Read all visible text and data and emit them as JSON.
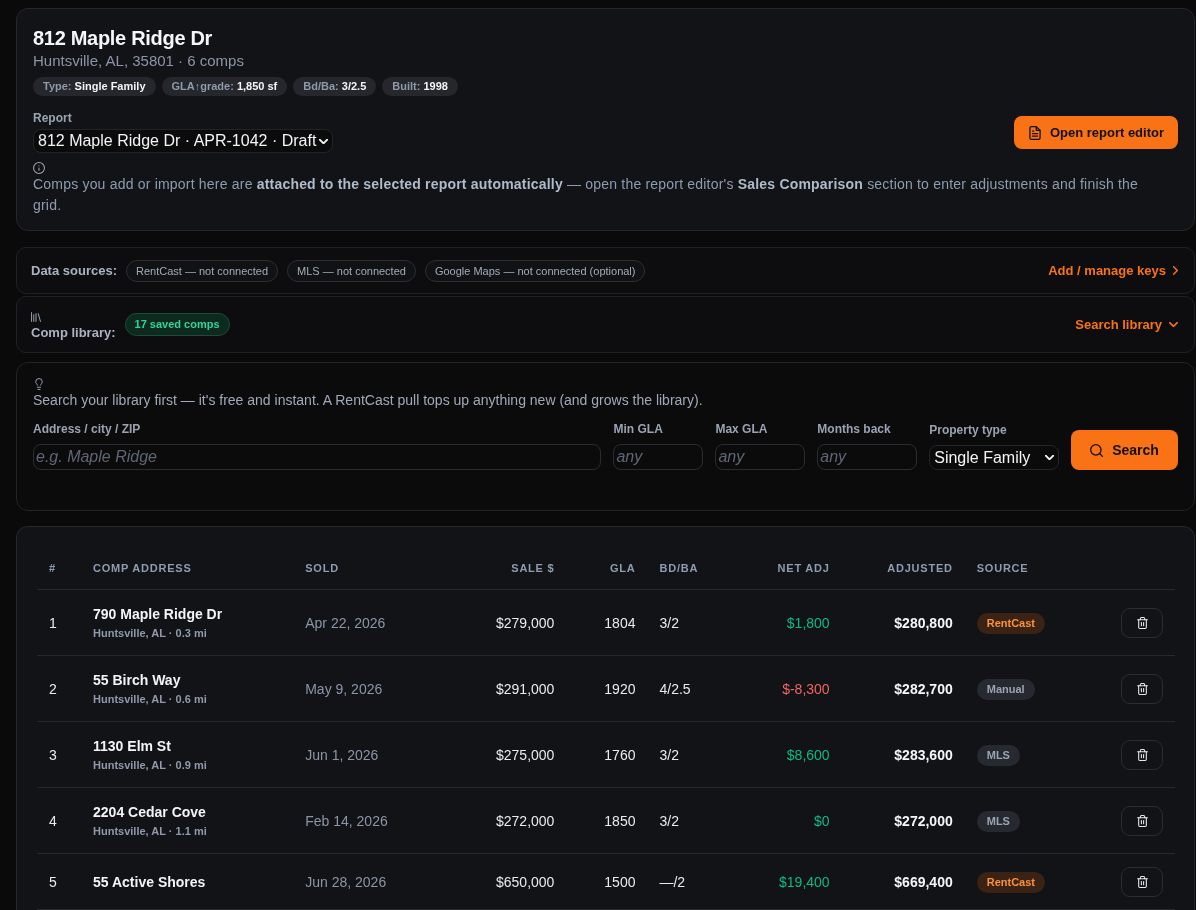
{
  "subject": {
    "title": "812 Maple Ridge Dr",
    "subtitle": "Huntsville, AL, 35801 · 6 comps",
    "facts": [
      {
        "label": "Type:",
        "value": "Single Family"
      },
      {
        "label": "GLA↑grade:",
        "value": "1,850 sf"
      },
      {
        "label": "Bd/Ba:",
        "value": "3/2.5"
      },
      {
        "label": "Built:",
        "value": "1998"
      }
    ],
    "report": {
      "label": "Report",
      "value": "812 Maple Ridge Dr · APR-1042 · Draft"
    },
    "open_editor_button": "Open report editor",
    "note": "Comps you add or import here are **attached to the selected report automatically** — open the report editor's **Sales Comparison** section to enter adjustments and finish the grid."
  },
  "data_sources": {
    "label": "Data sources:",
    "sources": [
      "RentCast — not connected",
      "MLS — not connected",
      "Google Maps — not connected (optional)"
    ],
    "link": "Add / manage keys"
  },
  "comp_library": {
    "label": "Comp library:",
    "badge": "17 saved comps",
    "link": "Search library"
  },
  "search": {
    "hint": "Search your library first — it's free and instant. A RentCast pull tops up anything new (and grows the library).",
    "fields": [
      {
        "label": "Address / city / ZIP",
        "placeholder": "e.g. Maple Ridge"
      },
      {
        "label": "Min GLA",
        "placeholder": "any"
      },
      {
        "label": "Max GLA",
        "placeholder": "any"
      },
      {
        "label": "Months back",
        "placeholder": "any"
      }
    ],
    "property_type": {
      "label": "Property type",
      "value": "Single Family"
    },
    "button": "Search"
  },
  "table": {
    "columns": [
      "#",
      "COMP ADDRESS",
      "SOLD",
      "SALE $",
      "GLA",
      "BD/BA",
      "NET ADJ",
      "ADJUSTED",
      "SOURCE"
    ],
    "rows": [
      {
        "number": "1",
        "address": "790 Maple Ridge Dr",
        "area": "Huntsville, AL · 0.3 mi",
        "sold": "Apr 22, 2026",
        "sale": "$279,000",
        "gla": "1804",
        "bd_ba": "3/2",
        "net_adj": {
          "text": "$1,800",
          "color": "#10b981"
        },
        "adjusted": "$280,800",
        "source": {
          "label": "RentCast",
          "kind": "api"
        }
      },
      {
        "number": "2",
        "address": "55 Birch Way",
        "area": "Huntsville, AL · 0.6 mi",
        "sold": "May 9, 2026",
        "sale": "$291,000",
        "gla": "1920",
        "bd_ba": "4/2.5",
        "net_adj": {
          "text": "$-8,300",
          "color": "#ef6461"
        },
        "adjusted": "$282,700",
        "source": {
          "label": "Manual",
          "kind": "other"
        }
      },
      {
        "number": "3",
        "address": "1130 Elm St",
        "area": "Huntsville, AL · 0.9 mi",
        "sold": "Jun 1, 2026",
        "sale": "$275,000",
        "gla": "1760",
        "bd_ba": "3/2",
        "net_adj": {
          "text": "$8,600",
          "color": "#10b981"
        },
        "adjusted": "$283,600",
        "source": {
          "label": "MLS",
          "kind": "other"
        }
      },
      {
        "number": "4",
        "address": "2204 Cedar Cove",
        "area": "Huntsville, AL · 1.1 mi",
        "sold": "Feb 14, 2026",
        "sale": "$272,000",
        "gla": "1850",
        "bd_ba": "3/2",
        "net_adj": {
          "text": "$0",
          "color": "#10b981"
        },
        "adjusted": "$272,000",
        "source": {
          "label": "MLS",
          "kind": "other"
        }
      },
      {
        "number": "5",
        "address": "55 Active Shores",
        "sold": "Jun 28, 2026",
        "sale": "$650,000",
        "gla": "1500",
        "bd_ba": "—/2",
        "net_adj": {
          "text": "$19,400",
          "color": "#10b981"
        },
        "adjusted": "$669,400",
        "source": {
          "label": "RentCast",
          "kind": "api"
        }
      }
    ]
  }
}
